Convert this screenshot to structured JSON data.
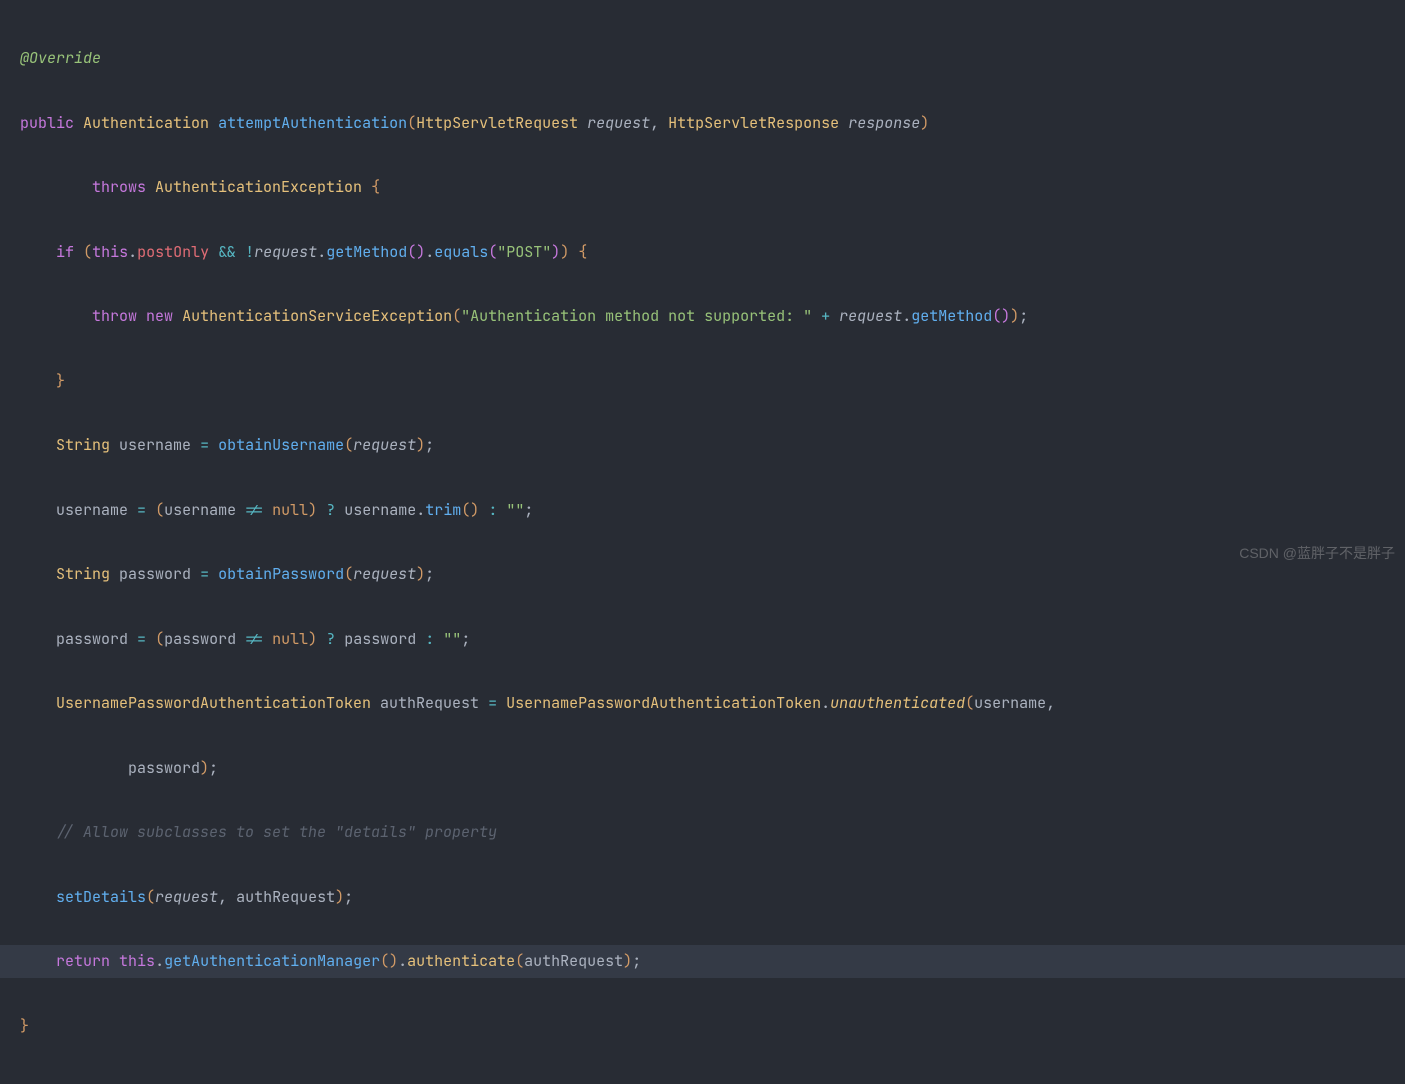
{
  "code": {
    "annotation": "@Override",
    "kw_public": "public",
    "type_auth": "Authentication",
    "method_name": "attemptAuthentication",
    "type_req": "HttpServletRequest",
    "param_req": "request",
    "type_res": "HttpServletResponse",
    "param_res": "response",
    "kw_throws": "throws",
    "type_authex": "AuthenticationException",
    "kw_if": "if",
    "kw_this": "this",
    "field_postonly": "postOnly",
    "op_and": "&&",
    "op_not": "!",
    "method_getmethod": "getMethod",
    "method_equals": "equals",
    "str_post": "\"POST\"",
    "kw_throw": "throw",
    "kw_new": "new",
    "type_authsvcex": "AuthenticationServiceException",
    "str_authmsg": "\"Authentication method not supported: \"",
    "op_plus": "+",
    "type_string": "String",
    "var_username": "username",
    "method_obtainuser": "obtainUsername",
    "kw_null": "null",
    "op_neq": "!=",
    "method_trim": "trim",
    "str_empty": "\"\"",
    "var_password": "password",
    "method_obtainpass": "obtainPassword",
    "type_token": "UsernamePasswordAuthenticationToken",
    "var_authreq": "authRequest",
    "method_unauth": "unauthenticated",
    "comment_details": "// Allow subclasses to set the \"details\" property",
    "method_setdetails": "setDetails",
    "kw_return": "return",
    "method_getauthmgr": "getAuthenticationManager",
    "method_authenticate": "authenticate"
  },
  "watermark": "CSDN @蓝胖子不是胖子"
}
